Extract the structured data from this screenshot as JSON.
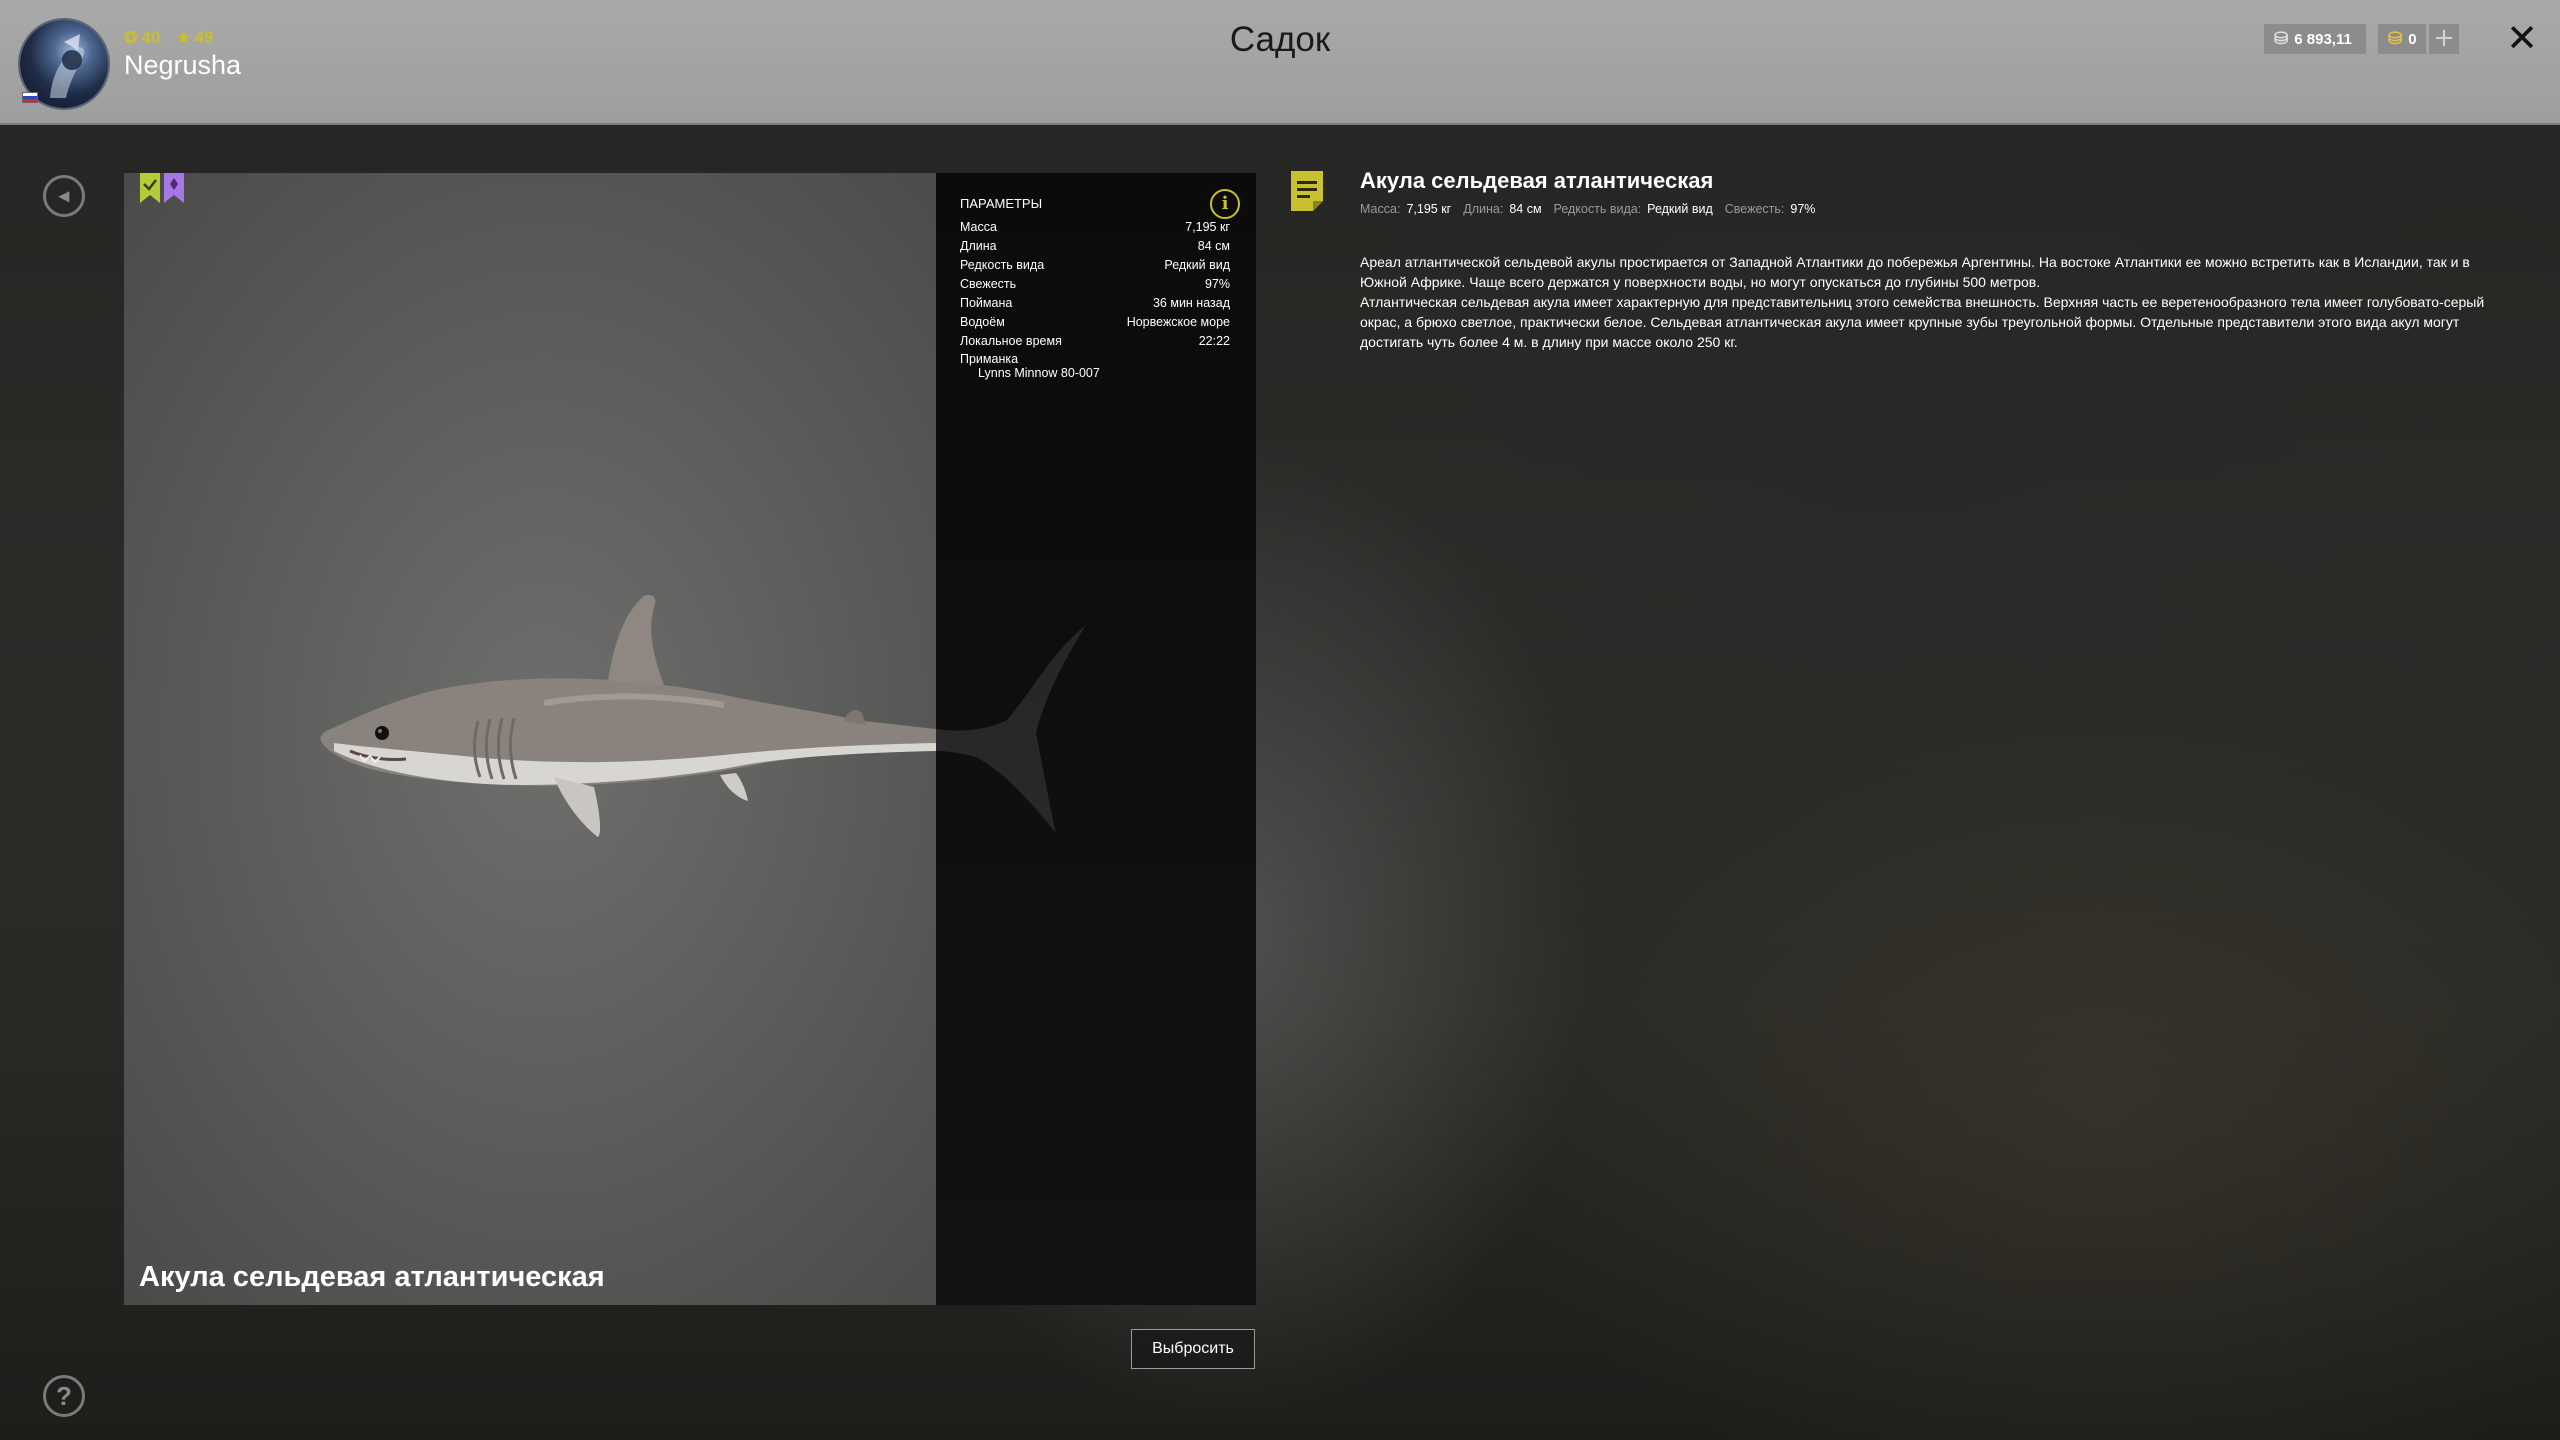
{
  "header": {
    "title": "Садок",
    "user": {
      "name": "Negrusha",
      "level": "40",
      "rank": "49"
    },
    "currency": {
      "silver": "6 893,11",
      "gold": "0",
      "add_symbol": "+"
    },
    "close_symbol": "✕"
  },
  "sidebar": {
    "back_symbol": "◂",
    "help_symbol": "?"
  },
  "fish": {
    "caption": "Акула сельдевая атлантическая"
  },
  "params": {
    "title": "Параметры",
    "info_symbol": "i",
    "rows": [
      {
        "label": "Масса",
        "value": "7,195 кг"
      },
      {
        "label": "Длина",
        "value": "84 см"
      },
      {
        "label": "Редкость вида",
        "value": "Редкий вид"
      },
      {
        "label": "Свежесть",
        "value": "97%"
      },
      {
        "label": "Поймана",
        "value": "36 мин назад"
      },
      {
        "label": "Водоём",
        "value": "Норвежское море"
      },
      {
        "label": "Локальное время",
        "value": "22:22"
      }
    ],
    "bait_label": "Приманка",
    "bait_value": "Lynns Minnow 80-007"
  },
  "actions": {
    "discard_label": "Выбросить"
  },
  "description": {
    "title": "Акула сельдевая атлантическая",
    "meta": [
      {
        "label": "Масса:",
        "value": "7,195 кг"
      },
      {
        "label": "Длина:",
        "value": "84 см"
      },
      {
        "label": "Редкость вида:",
        "value": "Редкий вид"
      },
      {
        "label": "Свежесть:",
        "value": "97%"
      }
    ],
    "paragraph1": "Ареал атлантической сельдевой акулы простирается от Западной Атлантики до побережья Аргентины. На востоке Атлантики ее можно встретить как в Исландии, так и в Южной Африке. Чаще всего держатся у поверхности воды, но могут опускаться до глубины 500 метров.",
    "paragraph2": "Атлантическая сельдевая акула имеет характерную для представительниц этого семейства внешность. Верхняя часть ее веретенообразного тела имеет голубовато-серый окрас, а брюхо светлое, практически белое. Сельдевая атлантическая акула имеет крупные зубы треугольной формы. Отдельные представители этого вида акул могут достигать чуть более 4 м. в длину при массе около 250 кг."
  },
  "colors": {
    "accent": "#c9c030",
    "bookmark_green": "#b5cc3a",
    "bookmark_purple": "#a877e6",
    "header_bg": "#a9a9a9"
  }
}
